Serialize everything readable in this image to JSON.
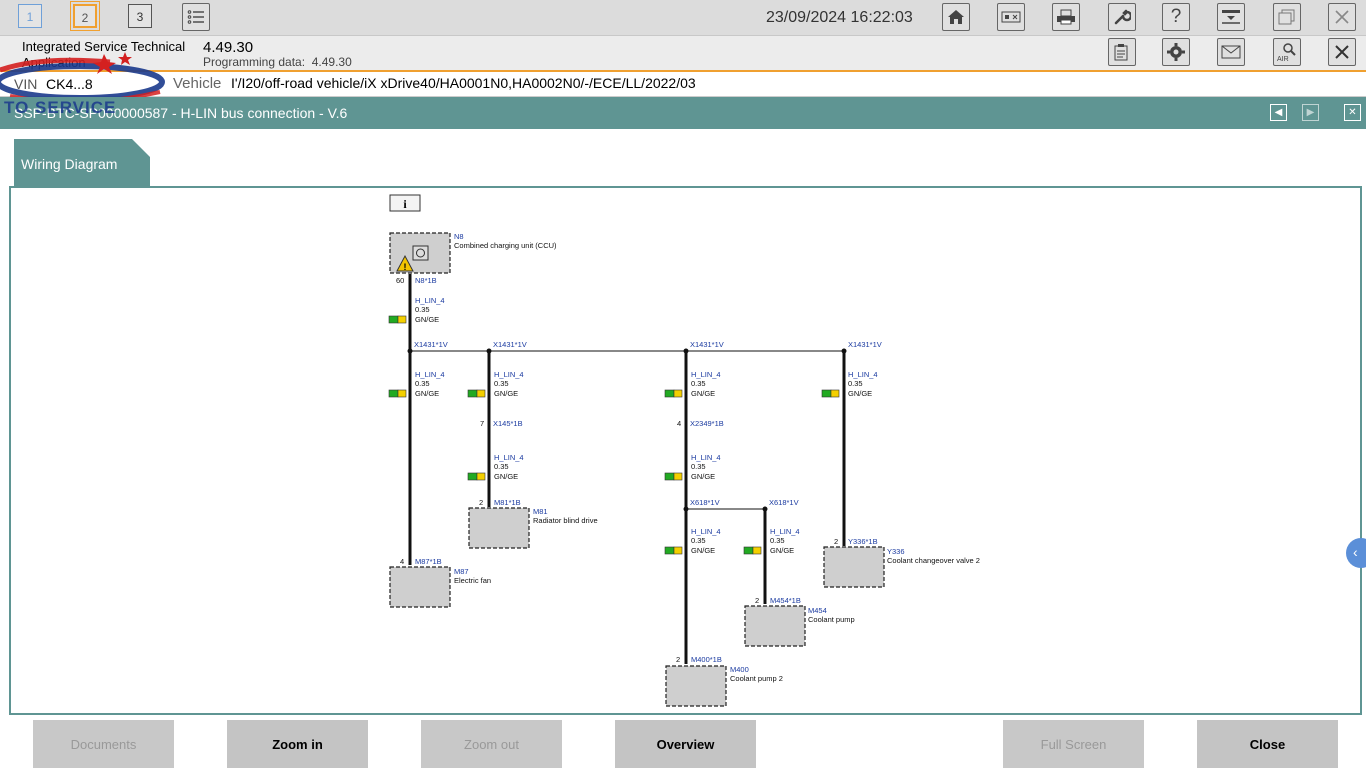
{
  "topbar": {
    "tabs": [
      "1",
      "2",
      "3"
    ],
    "datetime": "23/09/2024 16:22:03"
  },
  "app": {
    "name_line1": "Integrated Service Technical",
    "name_line2": "Application",
    "version": "4.49.30",
    "programming_data_label": "Programming data:",
    "programming_data_value": "4.49.30"
  },
  "vehicle": {
    "vin_label": "VIN",
    "vin_value": "CK4...8",
    "vehicle_label": "Vehicle",
    "vehicle_value": "I'/I20/off-road vehicle/iX xDrive40/HA0001N0,HA0002N0/-/ECE/LL/2022/03"
  },
  "document": {
    "title": "SSP-BTC-SP000000587 - H-LIN bus connection - V.6",
    "tab_label": "Wiring Diagram"
  },
  "watermark": {
    "text": "TO SERVICE"
  },
  "wiring": {
    "info_button": "i",
    "wire_label": "H_LIN_4",
    "wire_size": "0.35",
    "wire_color": "GN/GE",
    "components": [
      {
        "id": "N8",
        "name": "Combined charging unit (CCU)",
        "connector": "N8*1B",
        "pin": "60"
      },
      {
        "id": "M87",
        "name": "Electric fan",
        "connector": "M87*1B",
        "pin": "4"
      },
      {
        "id": "M81",
        "name": "Radiator blind drive",
        "connector": "M81*1B",
        "pin": "2"
      },
      {
        "id": "Y336",
        "name": "Coolant changeover valve 2",
        "connector": "Y336*1B",
        "pin": "2"
      },
      {
        "id": "M454",
        "name": "Coolant pump",
        "connector": "M454*1B",
        "pin": "2"
      },
      {
        "id": "M400",
        "name": "Coolant pump 2",
        "connector": "M400*1B",
        "pin": "2"
      }
    ],
    "splices": [
      "X1431*1V",
      "X1431*1V",
      "X1431*1V",
      "X1431*1V"
    ],
    "connectors": [
      {
        "id": "X145*1B",
        "pin": "7"
      },
      {
        "id": "X2349*1B",
        "pin": "4"
      },
      {
        "id": "X618*1V",
        "pin": ""
      },
      {
        "id": "X618*1V",
        "pin": ""
      }
    ],
    "colors": {
      "wire_green": "#22aa22",
      "wire_yellow": "#f4d000"
    }
  },
  "buttons": {
    "documents": "Documents",
    "zoom_in": "Zoom in",
    "zoom_out": "Zoom out",
    "overview": "Overview",
    "full_screen": "Full Screen",
    "close": "Close"
  }
}
